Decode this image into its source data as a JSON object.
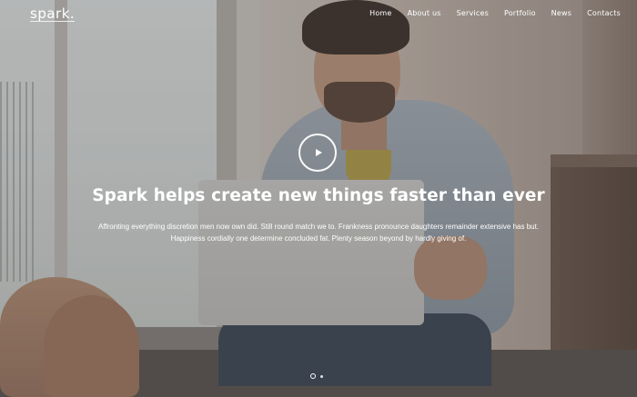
{
  "header": {
    "logo": "spark."
  },
  "nav": {
    "items": [
      {
        "label": "Home"
      },
      {
        "label": "About us"
      },
      {
        "label": "Services"
      },
      {
        "label": "Portfolio"
      },
      {
        "label": "News"
      },
      {
        "label": "Contacts"
      }
    ]
  },
  "hero": {
    "play_icon": "play-icon",
    "headline": "Spark helps create new things faster than ever",
    "description_line1": "Affronting everything discretion men now own did. Still round match we to. Frankness pronounce daughters remainder extensive has but.",
    "description_line2": "Happiness cordially one determine concluded fat. Plenty season beyond by hardly giving of.",
    "slides_count": 2,
    "active_slide": 1
  },
  "colors": {
    "text": "#ffffff",
    "overlay": "rgba(60,58,60,0.30)"
  }
}
